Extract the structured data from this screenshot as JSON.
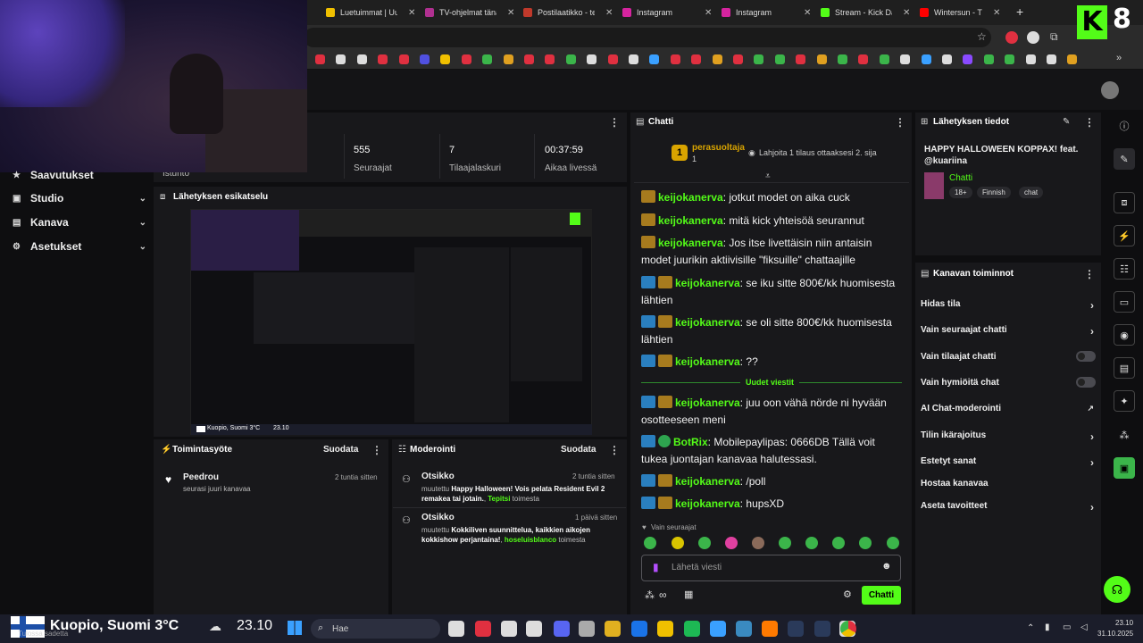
{
  "browser": {
    "tabs": [
      {
        "label": "Luetuimmat | Uut",
        "color": "#f0c000"
      },
      {
        "label": "TV-ohjelmat tänä",
        "color": "#b03090"
      },
      {
        "label": "Postilaatikko - tec",
        "color": "#c0392b"
      },
      {
        "label": "Instagram",
        "color": "#d6249f"
      },
      {
        "label": "Instagram",
        "color": "#d6249f"
      },
      {
        "label": "Stream - Kick Das",
        "color": "#53fc18"
      },
      {
        "label": "Wintersun - T",
        "color": "#ff0000"
      }
    ],
    "new_tab": "+",
    "logo_text": "K",
    "logo_number": "8"
  },
  "nav": {
    "items": [
      {
        "label": "Saavutukset",
        "icon": "trophy-icon"
      },
      {
        "label": "Studio",
        "icon": "studio-icon"
      },
      {
        "label": "Kanava",
        "icon": "channel-icon"
      },
      {
        "label": "Asetukset",
        "icon": "gear-icon"
      }
    ]
  },
  "stats": {
    "partial_label": "Istunto",
    "items": [
      {
        "value": "555",
        "label": "Seuraajat"
      },
      {
        "value": "7",
        "label": "Tilaajalaskuri"
      },
      {
        "value": "00:37:59",
        "label": "Aikaa livessä"
      }
    ]
  },
  "preview": {
    "title": "Lähetyksen esikatselu",
    "weather_label": "Kuopio, Suomi 3°C",
    "time": "23.10"
  },
  "activity": {
    "title": "Toimintasyöte",
    "filter": "Suodata",
    "items": [
      {
        "name": "Peedrou",
        "text": "seurasi juuri kanavaa",
        "time": "2 tuntia sitten"
      }
    ]
  },
  "moderation": {
    "title": "Moderointi",
    "filter": "Suodata",
    "items": [
      {
        "heading": "Otsikko",
        "prefix": "muutettu ",
        "title": "Happy Halloween! Vois pelata Resident Evil 2 remakea tai jotain.",
        "user": "Tepitsi",
        "suffix": " toimesta",
        "time": "2 tuntia sitten"
      },
      {
        "heading": "Otsikko",
        "prefix": "muutettu ",
        "title": "Kokkiliven suunnittelua, kaikkien aikojen kokkishow perjantaina!",
        "user": "hoseluisblanco",
        "suffix": " toimesta",
        "time": "1 päivä sitten"
      }
    ]
  },
  "chat": {
    "title": "Chatti",
    "pinned": {
      "rank": "1",
      "user": "perasuoltaja",
      "count": "1",
      "gift_text": "Lahjoita 1 tilaus ottaaksesi 2. sija"
    },
    "messages": [
      {
        "user": "keijokanerva",
        "text": "jotkut modet on aika cuck",
        "badges": "crown"
      },
      {
        "user": "keijokanerva",
        "text": "mitä kick yhteisöä seurannut",
        "badges": "crown"
      },
      {
        "user": "keijokanerva",
        "text": "Jos itse livettäisin niin antaisin modet juurikin aktiivisille \"fiksuille\" chattaajille",
        "badges": "crown"
      },
      {
        "user": "keijokanerva",
        "text": "se iku sitte 800€/kk huomisesta lähtien",
        "badges": "blue-crown"
      },
      {
        "user": "keijokanerva",
        "text": "se oli sitte 800€/kk huomisesta lähtien",
        "badges": "blue-crown"
      },
      {
        "user": "keijokanerva",
        "text": "??",
        "badges": "blue-crown"
      },
      {
        "user": "keijokanerva",
        "text": "juu oon vähä nörde ni hyvään osotteeseen meni",
        "badges": "blue-crown"
      },
      {
        "user": "BotRix",
        "text": "Mobilepaylipas: 0666DB Tällä voit tukea juontajan kanavaa halutessasi.",
        "badges": "blue-green"
      },
      {
        "user": "keijokanerva",
        "text": "/poll",
        "badges": "blue-crown"
      },
      {
        "user": "keijokanerva",
        "text": "hupsXD",
        "badges": "blue-crown"
      }
    ],
    "new_messages_label": "Uudet viestit",
    "followers_only": "Vain seuraajat",
    "input_placeholder": "Lähetä viesti",
    "send_button": "Chatti"
  },
  "stream_info": {
    "title": "Lähetyksen tiedot",
    "stream_title": "HAPPY HALLOWEEN KOPPAX! feat. @kuariina",
    "category": "Chatti",
    "tags": [
      "18+",
      "Finnish",
      "chat"
    ]
  },
  "channel_actions": {
    "title": "Kanavan toiminnot",
    "items": [
      {
        "label": "Hidas tila",
        "kind": "chevron"
      },
      {
        "label": "Vain seuraajat chatti",
        "kind": "chevron"
      },
      {
        "label": "Vain tilaajat chatti",
        "kind": "toggle"
      },
      {
        "label": "Vain hymiöitä chat",
        "kind": "toggle"
      },
      {
        "label": "AI Chat-moderointi",
        "kind": "external"
      },
      {
        "label": "Tilin ikärajoitus",
        "kind": "chevron"
      },
      {
        "label": "Estetyt sanat",
        "kind": "chevron"
      },
      {
        "label": "Hostaa kanavaa",
        "kind": "none"
      },
      {
        "label": "Aseta tavoitteet",
        "kind": "chevron"
      }
    ]
  },
  "taskbar": {
    "weather": "Kuopio, Suomi 3°C",
    "weather_sub": "Tulossa sadetta",
    "time_big": "23.10",
    "search_placeholder": "Hae",
    "clock_time": "23.10",
    "clock_date": "31.10.2025"
  }
}
